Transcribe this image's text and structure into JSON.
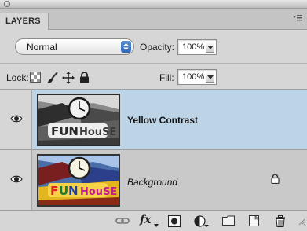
{
  "panel": {
    "tab_label": "LAYERS",
    "blend_mode": "Normal",
    "opacity_label": "Opacity:",
    "opacity_value": "100%",
    "lock_label": "Lock:",
    "fill_label": "Fill:",
    "fill_value": "100%"
  },
  "layers": [
    {
      "name": "Yellow Contrast",
      "style": "bold",
      "selected": true,
      "visible": true,
      "locked": false,
      "thumbnail": "grayscale"
    },
    {
      "name": "Background",
      "style": "italic",
      "selected": false,
      "visible": true,
      "locked": true,
      "thumbnail": "color"
    }
  ],
  "colors": {
    "panel_bg": "#d6d6d6",
    "selected_row": "#bdd3e6",
    "rows_bg": "#c9c9c9",
    "accent_stepper": "#2f66b8"
  },
  "icons": {
    "lock_options": [
      "lock-transparent-pixels-icon",
      "lock-image-pixels-icon",
      "lock-position-icon",
      "lock-all-icon"
    ],
    "footer": [
      "link-layers-icon",
      "layer-style-fx-icon",
      "add-mask-icon",
      "adjustment-layer-icon",
      "new-group-icon",
      "new-layer-icon",
      "delete-layer-icon"
    ],
    "footer_fx_label": "fx"
  }
}
